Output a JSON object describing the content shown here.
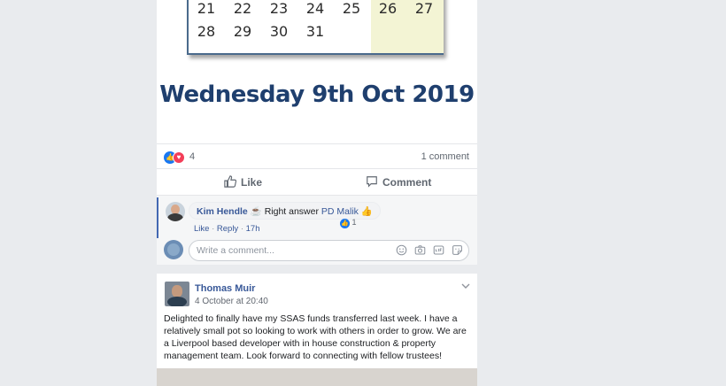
{
  "calendar": {
    "rows": [
      [
        "21",
        "22",
        "23",
        "24",
        "25",
        "26",
        "27"
      ],
      [
        "28",
        "29",
        "30",
        "31",
        "",
        "",
        ""
      ]
    ],
    "date_caption": "Wednesday 9th Oct 2019"
  },
  "post1": {
    "reaction_count": "4",
    "comment_count": "1 comment",
    "like_label": "Like",
    "comment_label": "Comment",
    "comment": {
      "author": "Kim Hendle",
      "emoji": "☕",
      "text": "Right answer",
      "mention": "PD Malik",
      "thumb": "👍",
      "reaction_count": "1",
      "like_link": "Like",
      "reply_link": "Reply",
      "age": "17h"
    },
    "write_placeholder": "Write a comment..."
  },
  "post2": {
    "author": "Thomas Muir",
    "time": "4 October at 20:40",
    "text": "Delighted to finally have my SSAS funds transferred last week. I have a relatively small pot so looking to work with others in order to grow. We are a Liverpool based developer with in house construction & property management team. Look forward to connecting with fellow trustees!"
  },
  "colors": {
    "link": "#385898",
    "like_blue": "#1877f2",
    "love_red": "#f33e58",
    "page_bg": "#e9ebee",
    "calendar_text": "#1f3f6e"
  },
  "icons": [
    "like-reaction-icon",
    "love-reaction-icon",
    "thumbs-up-icon",
    "comment-icon",
    "emoji-icon",
    "camera-icon",
    "gif-icon",
    "sticker-icon",
    "chevron-down-icon"
  ]
}
